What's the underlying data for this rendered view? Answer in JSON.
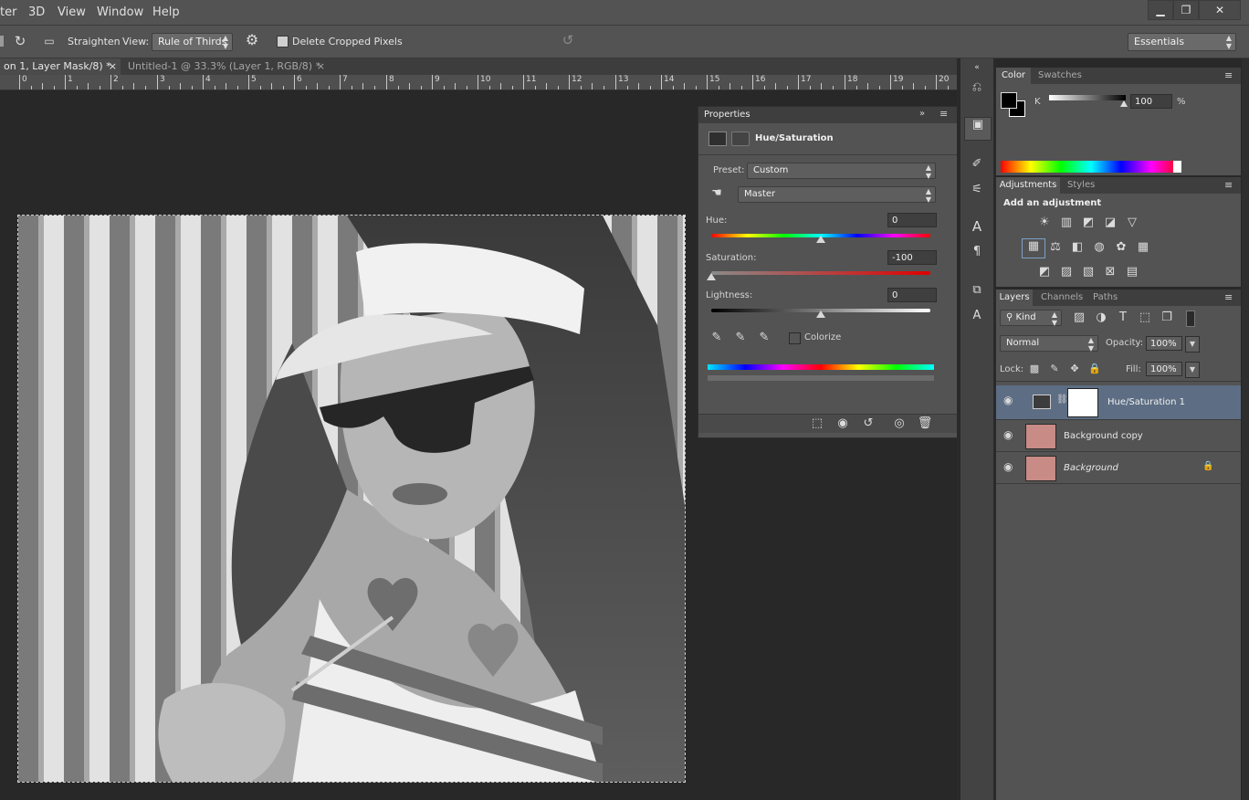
{
  "menubar": {
    "items": [
      "ter",
      "3D",
      "View",
      "Window",
      "Help"
    ],
    "minimize": "▁",
    "restore": "❐",
    "close": "✕"
  },
  "options": {
    "straighten_label": "Straighten",
    "view_label": "View:",
    "view_value": "Rule of Thirds",
    "delete_cropped": "Delete Cropped Pixels",
    "workspace": "Essentials"
  },
  "tabs": [
    {
      "label": "on 1, Layer Mask/8) *",
      "close": "×"
    },
    {
      "label": "Untitled-1 @ 33.3% (Layer 1, RGB/8) *",
      "close": "×"
    }
  ],
  "ruler": {
    "ticks": [
      "0",
      "1",
      "2",
      "3",
      "4",
      "5",
      "6",
      "7",
      "8",
      "9",
      "10",
      "11",
      "12",
      "13",
      "14",
      "15",
      "16",
      "17",
      "18",
      "19",
      "20"
    ]
  },
  "properties": {
    "tab": "Properties",
    "title": "Hue/Saturation",
    "preset_label": "Preset:",
    "preset_value": "Custom",
    "channel_value": "Master",
    "hue_label": "Hue:",
    "hue_value": "0",
    "saturation_label": "Saturation:",
    "saturation_value": "-100",
    "lightness_label": "Lightness:",
    "lightness_value": "0",
    "colorize_label": "Colorize",
    "hue_level": 0.5,
    "saturation_level": 0.0,
    "lightness_level": 0.5
  },
  "color_panel": {
    "tabs": [
      "Color",
      "Swatches"
    ],
    "k_label": "K",
    "k_value": "100",
    "percent": "%"
  },
  "adjustments_panel": {
    "tabs": [
      "Adjustments",
      "Styles"
    ],
    "heading": "Add an adjustment"
  },
  "layers_panel": {
    "tabs": [
      "Layers",
      "Channels",
      "Paths"
    ],
    "kind_label": "Kind",
    "blend_mode": "Normal",
    "opacity_label": "Opacity:",
    "opacity_value": "100%",
    "lock_label": "Lock:",
    "fill_label": "Fill:",
    "fill_value": "100%",
    "layers": [
      {
        "name": "Hue/Saturation 1"
      },
      {
        "name": "Background copy"
      },
      {
        "name": "Background"
      }
    ]
  },
  "colors": {
    "accent": "#5d6e84",
    "panel": "#535353",
    "canvas": "#282828"
  }
}
